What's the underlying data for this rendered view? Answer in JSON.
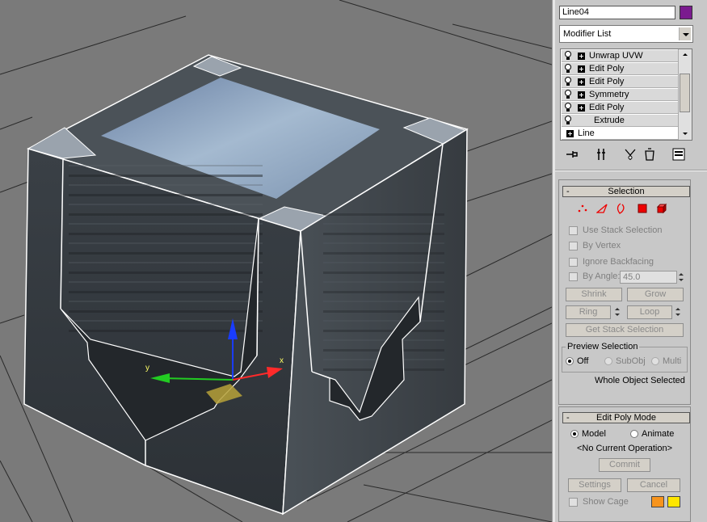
{
  "object": {
    "name": "Line04",
    "color": "#7b1b8f"
  },
  "modifier_list": {
    "label": "Modifier List"
  },
  "modifier_stack": [
    {
      "label": "Unwrap UVW",
      "bulb": true,
      "expand": true
    },
    {
      "label": "Edit Poly",
      "bulb": true,
      "expand": true
    },
    {
      "label": "Edit Poly",
      "bulb": true,
      "expand": true
    },
    {
      "label": "Symmetry",
      "bulb": true,
      "expand": true
    },
    {
      "label": "Edit Poly",
      "bulb": true,
      "expand": true
    },
    {
      "label": "Extrude",
      "bulb": true,
      "expand": false
    },
    {
      "label": "Line",
      "bulb": false,
      "expand": true
    }
  ],
  "toolbar_icons": [
    "pin-stack-icon",
    "show-end-result-icon",
    "make-unique-icon",
    "remove-modifier-icon",
    "configure-modifier-sets-icon"
  ],
  "selection": {
    "title": "Selection",
    "collapse": "-",
    "modes": [
      "vertex-icon",
      "edge-icon",
      "border-icon",
      "polygon-icon",
      "element-icon"
    ],
    "use_stack_selection": "Use Stack Selection",
    "by_vertex": "By Vertex",
    "ignore_backfacing": "Ignore Backfacing",
    "by_angle": "By Angle:",
    "angle_value": "45.0",
    "shrink": "Shrink",
    "grow": "Grow",
    "ring": "Ring",
    "loop": "Loop",
    "get_stack_selection": "Get Stack Selection",
    "preview_selection": "Preview Selection",
    "preview_off": "Off",
    "preview_subobj": "SubObj",
    "preview_multi": "Multi",
    "status": "Whole Object Selected"
  },
  "edit_poly_mode": {
    "title": "Edit Poly Mode",
    "collapse": "-",
    "model": "Model",
    "animate": "Animate",
    "current_operation": "<No Current Operation>",
    "commit": "Commit",
    "settings": "Settings",
    "cancel": "Cancel",
    "show_cage": "Show Cage",
    "cage_color_1": "#f7941d",
    "cage_color_2": "#ffe600"
  },
  "gizmo": {
    "x_label": "x",
    "y_label": "y"
  }
}
